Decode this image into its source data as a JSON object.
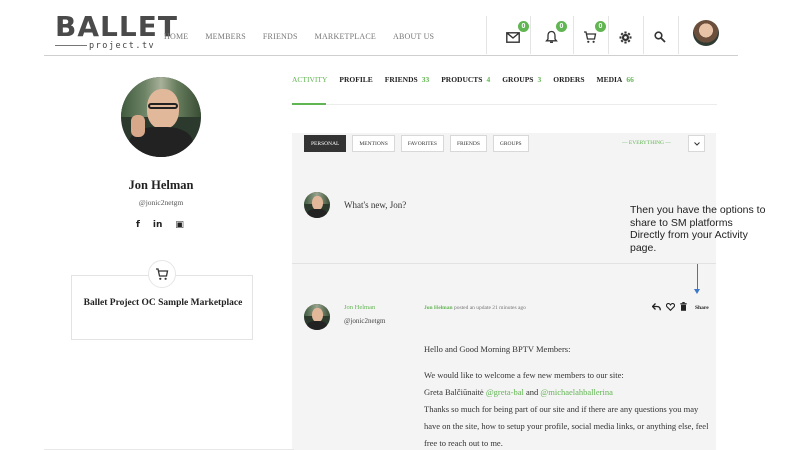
{
  "brand": {
    "name": "BALLET",
    "sub": "project.tv"
  },
  "nav": [
    "HOME",
    "MEMBERS",
    "FRIENDS",
    "MARKETPLACE",
    "ABOUT US"
  ],
  "header_icons": {
    "messages": {
      "icon": "envelope-icon",
      "badge": "0"
    },
    "notifications": {
      "icon": "bell-icon",
      "badge": "0"
    },
    "cart": {
      "icon": "cart-icon",
      "badge": "0"
    },
    "settings": {
      "icon": "gear-icon"
    },
    "search": {
      "icon": "search-icon"
    }
  },
  "profile": {
    "name": "Jon Helman",
    "handle": "@jonic2netgm",
    "social": [
      "f",
      "in",
      "▣"
    ]
  },
  "marketplace": {
    "icon": "cart-icon",
    "title": "Ballet Project OC Sample Marketplace"
  },
  "tabs": [
    {
      "label": "ACTIVITY",
      "count": ""
    },
    {
      "label": "PROFILE",
      "count": ""
    },
    {
      "label": "FRIENDS",
      "count": "33"
    },
    {
      "label": "PRODUCTS",
      "count": "4"
    },
    {
      "label": "GROUPS",
      "count": "3"
    },
    {
      "label": "ORDERS",
      "count": ""
    },
    {
      "label": "MEDIA",
      "count": "66"
    }
  ],
  "filters": [
    "PERSONAL",
    "MENTIONS",
    "FAVORITES",
    "FRIENDS",
    "GROUPS"
  ],
  "filter_select": "— EVERYTHING —",
  "whats_new": "What's new, Jon?",
  "post": {
    "author": "Jon Helman",
    "handle": "@jonic2netgm",
    "meta_name": "Jon Helman",
    "meta_text": " posted an update 21 minutes ago",
    "share_label": "Share",
    "greeting": "Hello and Good Morning BPTV Members:",
    "line1": "We would like to welcome a few new members to our site:",
    "member_name": "Greta Balčiūnaitė",
    "mention1": "@greta-bal",
    "and_word": "and",
    "mention2": "@michaelahballerina",
    "line3": "Thanks so much for being part of our site and if there are any questions you may have on the site, how to setup your profile, social media links, or anything else, feel free to reach out to me."
  },
  "annotation": "Then you have the options to share to SM platforms Directly from your Activity page.",
  "colors": {
    "accent": "#62b553",
    "annotation_arrow": "#3c78c8",
    "dark_button": "#333333"
  }
}
